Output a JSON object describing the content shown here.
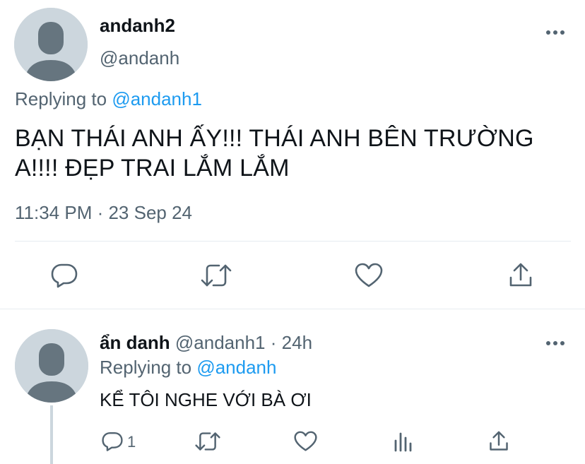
{
  "main_tweet": {
    "display_name": "andanh2",
    "handle": "@andanh",
    "replying_prefix": "Replying to",
    "replying_handle": "@andanh1",
    "text_line1": "BẠN THÁI ANH ẤY!!! THÁI ANH BÊN TRƯỜNG",
    "text_line2": "A!!!! ĐẸP TRAI LẮM LẮM",
    "timestamp": "11:34 PM · 23 Sep 24",
    "actions": [
      "reply-icon",
      "retweet-icon",
      "like-icon",
      "share-icon"
    ]
  },
  "reply_tweet": {
    "display_name": "ẩn danh",
    "handle": "@andanh1",
    "time": "· 24h",
    "replying_prefix": "Replying to",
    "replying_handle": "@andanh",
    "text": "KỂ TÔI NGHE VỚI BÀ ƠI",
    "reply_count": "1",
    "actions": [
      "reply-icon",
      "retweet-icon",
      "like-icon",
      "analytics-icon",
      "share-icon"
    ]
  },
  "colors": {
    "text": "#0f1419",
    "muted": "#536471",
    "link": "#1d9bf0",
    "divider": "#e6ecf0",
    "avatar_bg": "#ccd6dd",
    "avatar_fg": "#66757f"
  }
}
